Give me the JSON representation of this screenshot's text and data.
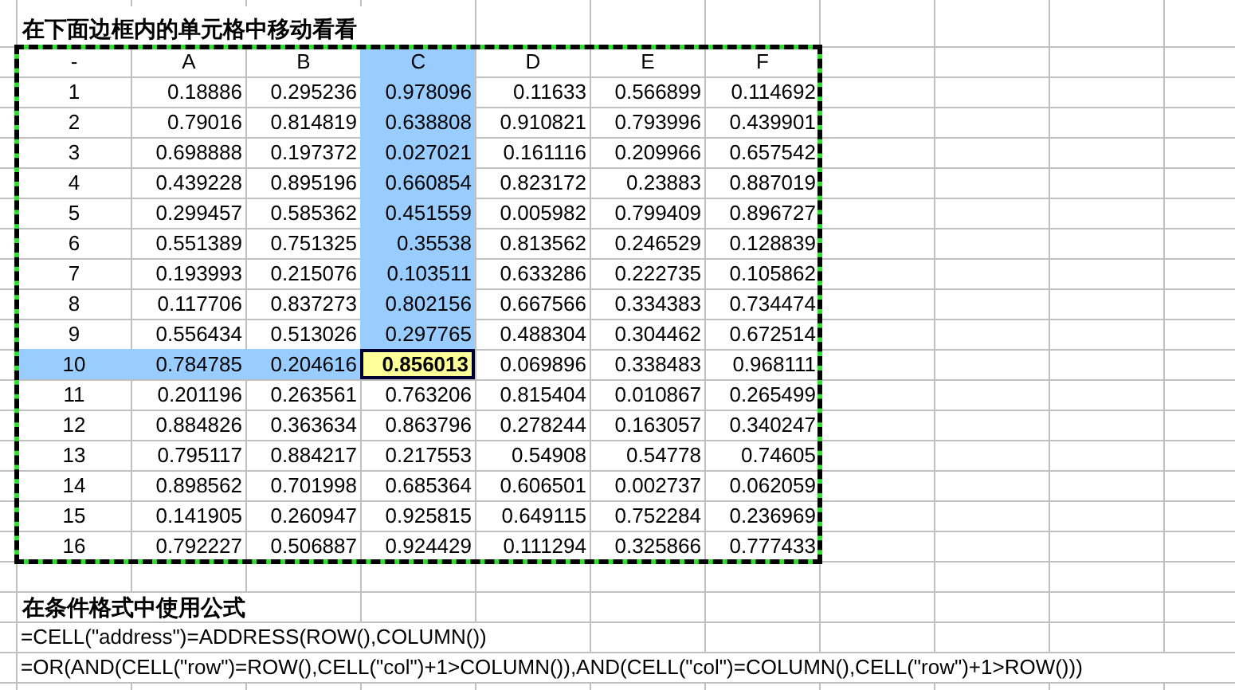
{
  "title": "在下面边框内的单元格中移动看看",
  "table": {
    "header": [
      {
        "text": "-",
        "highlighted": false,
        "selected": false
      },
      {
        "text": "A",
        "highlighted": false,
        "selected": false
      },
      {
        "text": "B",
        "highlighted": false,
        "selected": false
      },
      {
        "text": "C",
        "highlighted": true,
        "selected": false
      },
      {
        "text": "D",
        "highlighted": false,
        "selected": false
      },
      {
        "text": "E",
        "highlighted": false,
        "selected": false
      },
      {
        "text": "F",
        "highlighted": false,
        "selected": false
      }
    ],
    "rows": [
      {
        "cells": [
          {
            "text": "1",
            "highlighted": false,
            "selected": false
          },
          {
            "text": "0.18886",
            "highlighted": false,
            "selected": false
          },
          {
            "text": "0.295236",
            "highlighted": false,
            "selected": false
          },
          {
            "text": "0.978096",
            "highlighted": true,
            "selected": false
          },
          {
            "text": "0.11633",
            "highlighted": false,
            "selected": false
          },
          {
            "text": "0.566899",
            "highlighted": false,
            "selected": false
          },
          {
            "text": "0.114692",
            "highlighted": false,
            "selected": false
          }
        ]
      },
      {
        "cells": [
          {
            "text": "2",
            "highlighted": false,
            "selected": false
          },
          {
            "text": "0.79016",
            "highlighted": false,
            "selected": false
          },
          {
            "text": "0.814819",
            "highlighted": false,
            "selected": false
          },
          {
            "text": "0.638808",
            "highlighted": true,
            "selected": false
          },
          {
            "text": "0.910821",
            "highlighted": false,
            "selected": false
          },
          {
            "text": "0.793996",
            "highlighted": false,
            "selected": false
          },
          {
            "text": "0.439901",
            "highlighted": false,
            "selected": false
          }
        ]
      },
      {
        "cells": [
          {
            "text": "3",
            "highlighted": false,
            "selected": false
          },
          {
            "text": "0.698888",
            "highlighted": false,
            "selected": false
          },
          {
            "text": "0.197372",
            "highlighted": false,
            "selected": false
          },
          {
            "text": "0.027021",
            "highlighted": true,
            "selected": false
          },
          {
            "text": "0.161116",
            "highlighted": false,
            "selected": false
          },
          {
            "text": "0.209966",
            "highlighted": false,
            "selected": false
          },
          {
            "text": "0.657542",
            "highlighted": false,
            "selected": false
          }
        ]
      },
      {
        "cells": [
          {
            "text": "4",
            "highlighted": false,
            "selected": false
          },
          {
            "text": "0.439228",
            "highlighted": false,
            "selected": false
          },
          {
            "text": "0.895196",
            "highlighted": false,
            "selected": false
          },
          {
            "text": "0.660854",
            "highlighted": true,
            "selected": false
          },
          {
            "text": "0.823172",
            "highlighted": false,
            "selected": false
          },
          {
            "text": "0.23883",
            "highlighted": false,
            "selected": false
          },
          {
            "text": "0.887019",
            "highlighted": false,
            "selected": false
          }
        ]
      },
      {
        "cells": [
          {
            "text": "5",
            "highlighted": false,
            "selected": false
          },
          {
            "text": "0.299457",
            "highlighted": false,
            "selected": false
          },
          {
            "text": "0.585362",
            "highlighted": false,
            "selected": false
          },
          {
            "text": "0.451559",
            "highlighted": true,
            "selected": false
          },
          {
            "text": "0.005982",
            "highlighted": false,
            "selected": false
          },
          {
            "text": "0.799409",
            "highlighted": false,
            "selected": false
          },
          {
            "text": "0.896727",
            "highlighted": false,
            "selected": false
          }
        ]
      },
      {
        "cells": [
          {
            "text": "6",
            "highlighted": false,
            "selected": false
          },
          {
            "text": "0.551389",
            "highlighted": false,
            "selected": false
          },
          {
            "text": "0.751325",
            "highlighted": false,
            "selected": false
          },
          {
            "text": "0.35538",
            "highlighted": true,
            "selected": false
          },
          {
            "text": "0.813562",
            "highlighted": false,
            "selected": false
          },
          {
            "text": "0.246529",
            "highlighted": false,
            "selected": false
          },
          {
            "text": "0.128839",
            "highlighted": false,
            "selected": false
          }
        ]
      },
      {
        "cells": [
          {
            "text": "7",
            "highlighted": false,
            "selected": false
          },
          {
            "text": "0.193993",
            "highlighted": false,
            "selected": false
          },
          {
            "text": "0.215076",
            "highlighted": false,
            "selected": false
          },
          {
            "text": "0.103511",
            "highlighted": true,
            "selected": false
          },
          {
            "text": "0.633286",
            "highlighted": false,
            "selected": false
          },
          {
            "text": "0.222735",
            "highlighted": false,
            "selected": false
          },
          {
            "text": "0.105862",
            "highlighted": false,
            "selected": false
          }
        ]
      },
      {
        "cells": [
          {
            "text": "8",
            "highlighted": false,
            "selected": false
          },
          {
            "text": "0.117706",
            "highlighted": false,
            "selected": false
          },
          {
            "text": "0.837273",
            "highlighted": false,
            "selected": false
          },
          {
            "text": "0.802156",
            "highlighted": true,
            "selected": false
          },
          {
            "text": "0.667566",
            "highlighted": false,
            "selected": false
          },
          {
            "text": "0.334383",
            "highlighted": false,
            "selected": false
          },
          {
            "text": "0.734474",
            "highlighted": false,
            "selected": false
          }
        ]
      },
      {
        "cells": [
          {
            "text": "9",
            "highlighted": false,
            "selected": false
          },
          {
            "text": "0.556434",
            "highlighted": false,
            "selected": false
          },
          {
            "text": "0.513026",
            "highlighted": false,
            "selected": false
          },
          {
            "text": "0.297765",
            "highlighted": true,
            "selected": false
          },
          {
            "text": "0.488304",
            "highlighted": false,
            "selected": false
          },
          {
            "text": "0.304462",
            "highlighted": false,
            "selected": false
          },
          {
            "text": "0.672514",
            "highlighted": false,
            "selected": false
          }
        ]
      },
      {
        "cells": [
          {
            "text": "10",
            "highlighted": true,
            "selected": false
          },
          {
            "text": "0.784785",
            "highlighted": true,
            "selected": false
          },
          {
            "text": "0.204616",
            "highlighted": true,
            "selected": false
          },
          {
            "text": "0.856013",
            "highlighted": false,
            "selected": true
          },
          {
            "text": "0.069896",
            "highlighted": false,
            "selected": false
          },
          {
            "text": "0.338483",
            "highlighted": false,
            "selected": false
          },
          {
            "text": "0.968111",
            "highlighted": false,
            "selected": false
          }
        ]
      },
      {
        "cells": [
          {
            "text": "11",
            "highlighted": false,
            "selected": false
          },
          {
            "text": "0.201196",
            "highlighted": false,
            "selected": false
          },
          {
            "text": "0.263561",
            "highlighted": false,
            "selected": false
          },
          {
            "text": "0.763206",
            "highlighted": false,
            "selected": false
          },
          {
            "text": "0.815404",
            "highlighted": false,
            "selected": false
          },
          {
            "text": "0.010867",
            "highlighted": false,
            "selected": false
          },
          {
            "text": "0.265499",
            "highlighted": false,
            "selected": false
          }
        ]
      },
      {
        "cells": [
          {
            "text": "12",
            "highlighted": false,
            "selected": false
          },
          {
            "text": "0.884826",
            "highlighted": false,
            "selected": false
          },
          {
            "text": "0.363634",
            "highlighted": false,
            "selected": false
          },
          {
            "text": "0.863796",
            "highlighted": false,
            "selected": false
          },
          {
            "text": "0.278244",
            "highlighted": false,
            "selected": false
          },
          {
            "text": "0.163057",
            "highlighted": false,
            "selected": false
          },
          {
            "text": "0.340247",
            "highlighted": false,
            "selected": false
          }
        ]
      },
      {
        "cells": [
          {
            "text": "13",
            "highlighted": false,
            "selected": false
          },
          {
            "text": "0.795117",
            "highlighted": false,
            "selected": false
          },
          {
            "text": "0.884217",
            "highlighted": false,
            "selected": false
          },
          {
            "text": "0.217553",
            "highlighted": false,
            "selected": false
          },
          {
            "text": "0.54908",
            "highlighted": false,
            "selected": false
          },
          {
            "text": "0.54778",
            "highlighted": false,
            "selected": false
          },
          {
            "text": "0.74605",
            "highlighted": false,
            "selected": false
          }
        ]
      },
      {
        "cells": [
          {
            "text": "14",
            "highlighted": false,
            "selected": false
          },
          {
            "text": "0.898562",
            "highlighted": false,
            "selected": false
          },
          {
            "text": "0.701998",
            "highlighted": false,
            "selected": false
          },
          {
            "text": "0.685364",
            "highlighted": false,
            "selected": false
          },
          {
            "text": "0.606501",
            "highlighted": false,
            "selected": false
          },
          {
            "text": "0.002737",
            "highlighted": false,
            "selected": false
          },
          {
            "text": "0.062059",
            "highlighted": false,
            "selected": false
          }
        ]
      },
      {
        "cells": [
          {
            "text": "15",
            "highlighted": false,
            "selected": false
          },
          {
            "text": "0.141905",
            "highlighted": false,
            "selected": false
          },
          {
            "text": "0.260947",
            "highlighted": false,
            "selected": false
          },
          {
            "text": "0.925815",
            "highlighted": false,
            "selected": false
          },
          {
            "text": "0.649115",
            "highlighted": false,
            "selected": false
          },
          {
            "text": "0.752284",
            "highlighted": false,
            "selected": false
          },
          {
            "text": "0.236969",
            "highlighted": false,
            "selected": false
          }
        ]
      },
      {
        "cells": [
          {
            "text": "16",
            "highlighted": false,
            "selected": false
          },
          {
            "text": "0.792227",
            "highlighted": false,
            "selected": false
          },
          {
            "text": "0.506887",
            "highlighted": false,
            "selected": false
          },
          {
            "text": "0.924429",
            "highlighted": false,
            "selected": false
          },
          {
            "text": "0.111294",
            "highlighted": false,
            "selected": false
          },
          {
            "text": "0.325866",
            "highlighted": false,
            "selected": false
          },
          {
            "text": "0.777433",
            "highlighted": false,
            "selected": false
          }
        ]
      }
    ]
  },
  "notes": {
    "heading": "在条件格式中使用公式",
    "formulas": [
      "=CELL(\"address\")=ADDRESS(ROW(),COLUMN())",
      "=OR(AND(CELL(\"row\")=ROW(),CELL(\"col\")+1>COLUMN()),AND(CELL(\"col\")=COLUMN(),CELL(\"row\")+1>ROW()))"
    ]
  }
}
